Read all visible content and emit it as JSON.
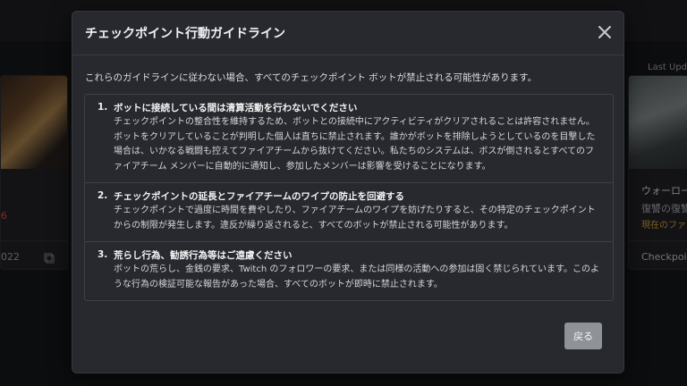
{
  "background": {
    "right_card": {
      "header": "Last Upda",
      "title": "ウォーロード",
      "subtitle": "復讐の復讐",
      "status": "現在のファ",
      "footer": "Checkpoi"
    },
    "left_card": {
      "accent_char": "6",
      "date": "022"
    }
  },
  "modal": {
    "title": "チェックポイント行動ガイドライン",
    "intro": "これらのガイドラインに従わない場合、すべてのチェックポイント ボットが禁止される可能性があります。",
    "rules": [
      {
        "number": "1.",
        "title": "ボットに接続している間は清算活動を行わないでください",
        "body": "チェックポイントの整合性を維持するため、ボットとの接続中にアクティビティがクリアされることは許容されません。ボットをクリアしていることが判明した個人は直ちに禁止されます。誰かがボットを排除しようとしているのを目撃した場合は、いかなる戦闘も控えてファイアチームから抜けてください。私たちのシステムは、ボスが倒されるとすべてのファイアチーム メンバーに自動的に通知し、参加したメンバーは影響を受けることになります。"
      },
      {
        "number": "2.",
        "title": "チェックポイントの延長とファイアチームのワイプの防止を回避する",
        "body": "チェックポイントで過度に時間を費やしたり、ファイアチームのワイプを妨げたりすると、その特定のチェックポイントからの制限が発生します。違反が繰り返されると、すべてのボットが禁止される可能性があります。"
      },
      {
        "number": "3.",
        "title": "荒らし行為、勧誘行為等はご遠慮ください",
        "body": "ボットの荒らし、金銭の要求、Twitch のフォロワーの要求、または同様の活動への参加は固く禁じられています。このような行為の検証可能な報告があった場合、すべてのボットが即時に禁止されます。"
      }
    ],
    "back_label": "戻る"
  },
  "colors": {
    "modal_bg": "#27292e",
    "accent_red": "#d9534f",
    "accent_yellow": "#e0b13a",
    "button_gray": "#8f9297"
  },
  "icons": {
    "close": "close-icon",
    "copy": "copy-icon"
  }
}
